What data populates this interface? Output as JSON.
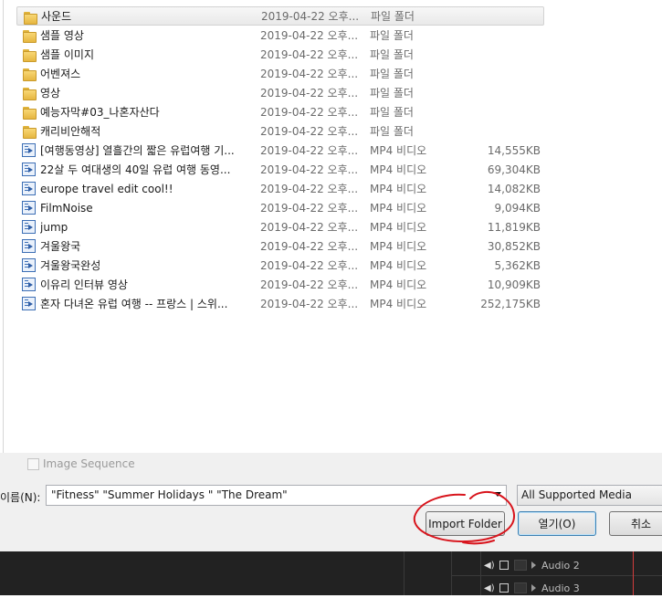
{
  "files": [
    {
      "icon": "folder-icon",
      "name": "사운드",
      "date": "2019-04-22 오후...",
      "type": "파일 폴더",
      "size": "",
      "selected": true
    },
    {
      "icon": "folder-icon",
      "name": "샘플 영상",
      "date": "2019-04-22 오후...",
      "type": "파일 폴더",
      "size": ""
    },
    {
      "icon": "folder-icon",
      "name": "샘플 이미지",
      "date": "2019-04-22 오후...",
      "type": "파일 폴더",
      "size": ""
    },
    {
      "icon": "folder-icon",
      "name": "어벤져스",
      "date": "2019-04-22 오후...",
      "type": "파일 폴더",
      "size": ""
    },
    {
      "icon": "folder-icon",
      "name": "영상",
      "date": "2019-04-22 오후...",
      "type": "파일 폴더",
      "size": ""
    },
    {
      "icon": "folder-icon",
      "name": "예능자막#03_나혼자산다",
      "date": "2019-04-22 오후...",
      "type": "파일 폴더",
      "size": ""
    },
    {
      "icon": "folder-icon",
      "name": "캐리비안해적",
      "date": "2019-04-22 오후...",
      "type": "파일 폴더",
      "size": ""
    },
    {
      "icon": "video-file-icon",
      "name": "[여행동영상] 열흘간의 짧은 유럽여행 기...",
      "date": "2019-04-22 오후...",
      "type": "MP4 비디오",
      "size": "14,555KB"
    },
    {
      "icon": "video-file-icon",
      "name": "22살 두 여대생의 40일 유럽 여행 동영...",
      "date": "2019-04-22 오후...",
      "type": "MP4 비디오",
      "size": "69,304KB"
    },
    {
      "icon": "video-file-icon",
      "name": "europe travel edit cool!!",
      "date": "2019-04-22 오후...",
      "type": "MP4 비디오",
      "size": "14,082KB"
    },
    {
      "icon": "video-file-icon",
      "name": "FilmNoise",
      "date": "2019-04-22 오후...",
      "type": "MP4 비디오",
      "size": "9,094KB"
    },
    {
      "icon": "video-file-icon",
      "name": "jump",
      "date": "2019-04-22 오후...",
      "type": "MP4 비디오",
      "size": "11,819KB"
    },
    {
      "icon": "video-file-icon",
      "name": "겨울왕국",
      "date": "2019-04-22 오후...",
      "type": "MP4 비디오",
      "size": "30,852KB"
    },
    {
      "icon": "video-file-icon",
      "name": "겨울왕국완성",
      "date": "2019-04-22 오후...",
      "type": "MP4 비디오",
      "size": "5,362KB"
    },
    {
      "icon": "video-file-icon",
      "name": "이유리 인터뷰 영상",
      "date": "2019-04-22 오후...",
      "type": "MP4 비디오",
      "size": "10,909KB"
    },
    {
      "icon": "video-file-icon",
      "name": "혼자 다녀온 유럽 여행 -- 프랑스 | 스위...",
      "date": "2019-04-22 오후...",
      "type": "MP4 비디오",
      "size": "252,175KB"
    }
  ],
  "image_sequence_label": "Image Sequence",
  "filename_label": "이름(N):",
  "filename_value": "\"Fitness\" \"Summer Holidays \" \"The Dream\"",
  "filter_value": "All Supported Media",
  "buttons": {
    "import_folder": "Import Folder",
    "open": "열기(O)",
    "cancel": "취소"
  },
  "tracks": [
    {
      "label": "Audio 2"
    },
    {
      "label": "Audio 3"
    }
  ],
  "colors": {
    "annotation": "#d8141c",
    "playhead": "#d23c3c",
    "folder": "#e6b640"
  }
}
